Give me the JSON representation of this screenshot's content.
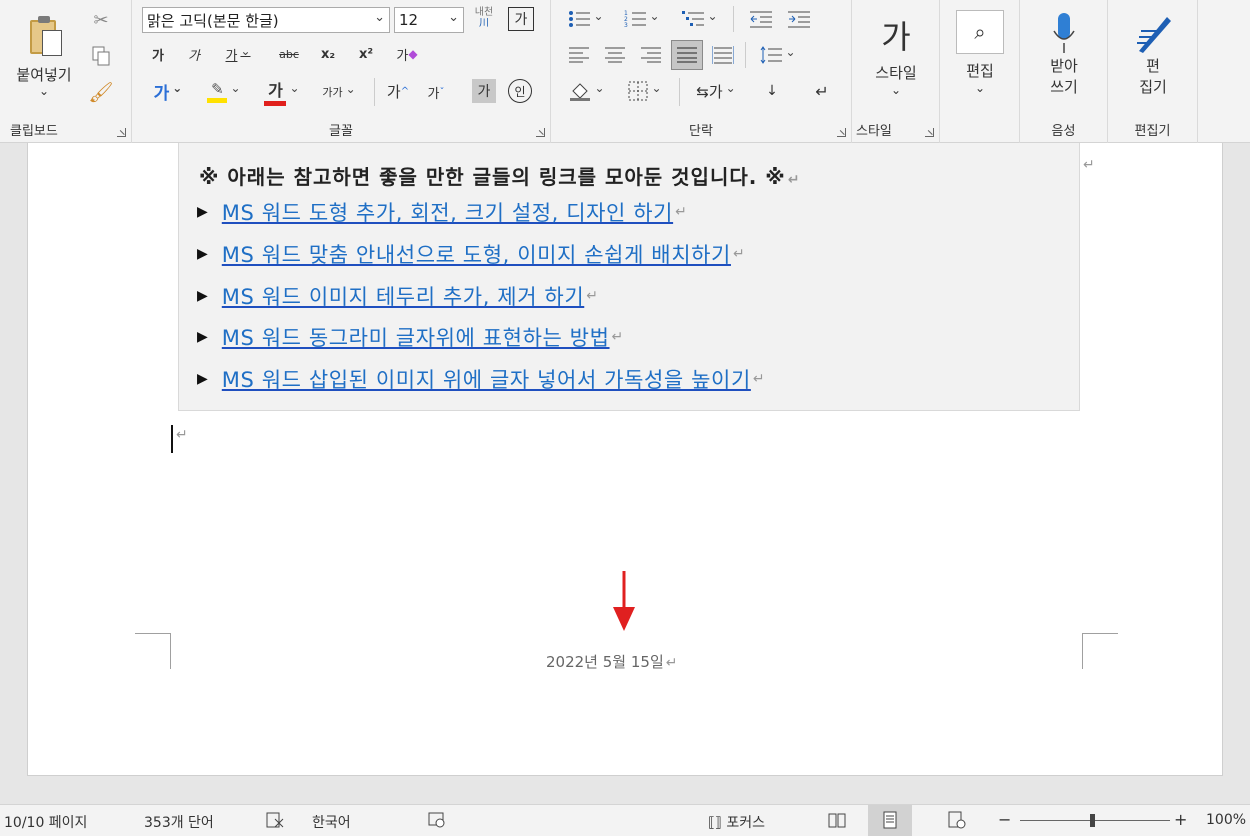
{
  "ribbon": {
    "clipboard": {
      "paste_label": "붙여넣기",
      "group_label": "클립보드"
    },
    "font": {
      "font_name": "맑은 고딕(본문 한글)",
      "font_size": "12",
      "phonetic_top": "내천",
      "phonetic_bottom": "川",
      "char_border": "가",
      "bold": "가",
      "italic": "가",
      "underline": "가",
      "strike": "abc",
      "sub": "x₂",
      "sup": "x²",
      "clear": "가",
      "text_effect": "가",
      "font_color": "가",
      "size_small": "가가",
      "grow": "가",
      "shrink": "가",
      "char_shade": "가",
      "enclose": "인",
      "group_label": "글꼴"
    },
    "paragraph": {
      "group_label": "단락"
    },
    "styles": {
      "glyph": "가",
      "label": "스타일",
      "group_label": "스타일"
    },
    "editing": {
      "label": "편집"
    },
    "voice": {
      "label_line1": "받아",
      "label_line2": "쓰기",
      "group_label": "음성"
    },
    "editor": {
      "label_line1": "편",
      "label_line2": "집기",
      "group_label": "편집기"
    }
  },
  "document": {
    "box_title": "※ 아래는 참고하면 좋을 만한 글들의 링크를 모아둔 것입니다. ※",
    "bullet": "▶",
    "pilcrow": "↵",
    "links": [
      "MS 워드 도형 추가, 회전, 크기 설정, 디자인 하기",
      "MS 워드 맞춤 안내선으로 도형, 이미지 손쉽게 배치하기",
      "MS 워드 이미지 테두리 추가, 제거 하기",
      "MS 워드 동그라미 글자위에 표현하는 방법",
      "MS 워드 삽입된 이미지 위에 글자 넣어서 가독성을 높이기"
    ],
    "footer_date": "2022년 5월 15일"
  },
  "statusbar": {
    "page": "10/10 페이지",
    "words": "353개 단어",
    "language": "한국어",
    "focus": "포커스",
    "zoom_minus": "−",
    "zoom_plus": "+",
    "zoom_level": "100%"
  },
  "colors": {
    "link": "#1f6fc5",
    "arrow": "#e02020",
    "ribbon_bg": "#f3f3f3"
  }
}
